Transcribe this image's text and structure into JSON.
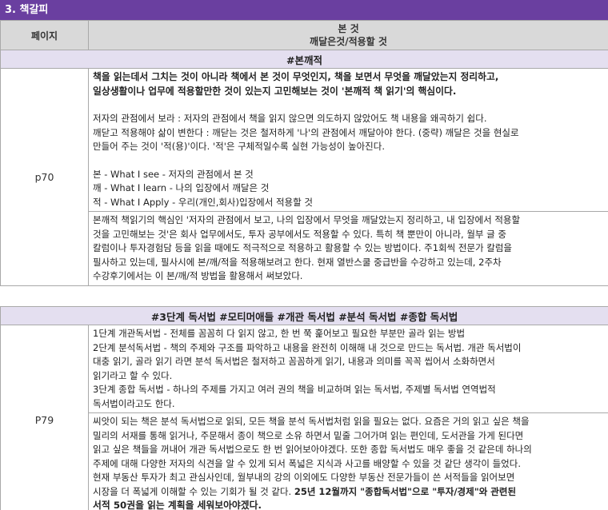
{
  "title": "3. 책갈피",
  "header": {
    "page_label": "페이지",
    "content_line1": "본 것",
    "content_line2": "깨달은것/적용할 것"
  },
  "block1": {
    "section": "#본깨적",
    "page": "p70",
    "main_bold": [
      "책을 읽는데서 그치는 것이 아니라 책에서 본 것이 무엇인지, 책을 보면서 무엇을 깨달았는지 정리하고,",
      "일상생활이나 업무에 적용할만한 것이 있는지 고민해보는 것이 '본깨적 책 읽기'의 핵심이다."
    ],
    "main_para": [
      "저자의 관점에서 보라 : 저자의 관점에서 책을 읽지 않으면 의도하지 않았어도 책 내용을 왜곡하기 쉽다.",
      "깨닫고 적용해야 삶이 변한다 : 깨닫는 것은 철저하게 '나'의 관점에서 깨달아야 한다. (중략) 깨달은 것을 현실로",
      "만들어 주는 것이 '적(용)'이다. '적'은 구체적일수록 실현 가능성이 높아진다."
    ],
    "main_list": [
      "본 - What I see - 저자의 관점에서 본 것",
      "깨 - What I learn - 나의 입장에서 깨달은 것",
      "적 - What I Apply - 우리(개인,회사)입장에서 적용할 것"
    ],
    "note": [
      "본깨적 책읽기의 핵심인 '저자의 관점에서 보고, 나의 입장에서 무엇을 깨달았는지 정리하고, 내 입장에서 적용할",
      "것을 고민해보는 것'은 회사 업무에서도, 투자 공부에서도 적용할 수 있다. 특히 책 뿐만이 아니라, 월부 글 중",
      "칼럼이나 투자경험담 등을 읽을 때에도 적극적으로 적용하고 활용할 수 있는 방법이다. 주1회씩 전문가 칼럼을",
      "필사하고 있는데, 필사시에 본/깨/적을 적용해보려고 한다. 현재 열반스쿨 중급반을 수강하고 있는데, 2주차",
      "수강후기에서는 이 본/깨/적 방법을 활용해서 써보았다."
    ]
  },
  "block2": {
    "section": "#3단계 독서법 #모티머애들 #개관 독서법 #분석 독서법 #종합 독서법",
    "page": "P79",
    "main": [
      "1단계 개관독서법 - 전체를 꼼꼼히 다 읽지 않고, 한 번 쭉 훑어보고 필요한 부분만 골라 읽는 방법",
      "2단계 분석독서법 - 책의 주제와 구조를 파악하고 내용을 완전히 이해해 내 것으로 만드는 독서법. 개관 독서법이",
      "대충 읽기, 골라 읽기 라면 분석 독서법은 철저하고 꼼꼼하게 읽기, 내용과 의미를 꼭꼭 씹어서 소화하면서",
      "읽기라고 할 수 있다.",
      "3단계 종합 독서법 - 하나의 주제를 가지고 여러 권의 책을 비교하며 읽는 독서법, 주제별 독서법 연역법적",
      "독서법이라고도 한다."
    ],
    "note": [
      "씨앗이 되는 책은 분석 독서법으로 읽되, 모든 책을 분석 독서법처럼 읽을 필요는 없다. 요즘은 거의 읽고 싶은 책을",
      "밀리의 서재를 통해 읽거나, 주문해서 종이 책으로 소유 하면서 밑줄 그어가며 읽는 편인데, 도서관을 가게 된다면",
      "읽고 싶은 책들을 꺼내어 개관 독서법으로도 한 번 읽어보아야겠다. 또한 종합 독서법도 매우 좋을 것 같은데 하나의",
      "주제에 대해 다양한 저자의 식견을 알 수 있게 되서 폭넓은 지식과 사고를 배양할 수 있을 것 같단 생각이 들었다.",
      "현재 부동산 투자가 최고 관심사인데, 월부내의 강의 이외에도 다양한 부동산 전문가들이 쓴 서적들을 읽어보면",
      "시장을 더 폭넓게 이해할 수 있는 기회가 될 것 같다."
    ],
    "note_bold_tail_a": "25년 12월까지 \"종합독서법\"으로 \"투자/경제\"와 관련된",
    "note_bold_tail_b": "서적 50권을 읽는 계획을 세워보아야겠다."
  }
}
